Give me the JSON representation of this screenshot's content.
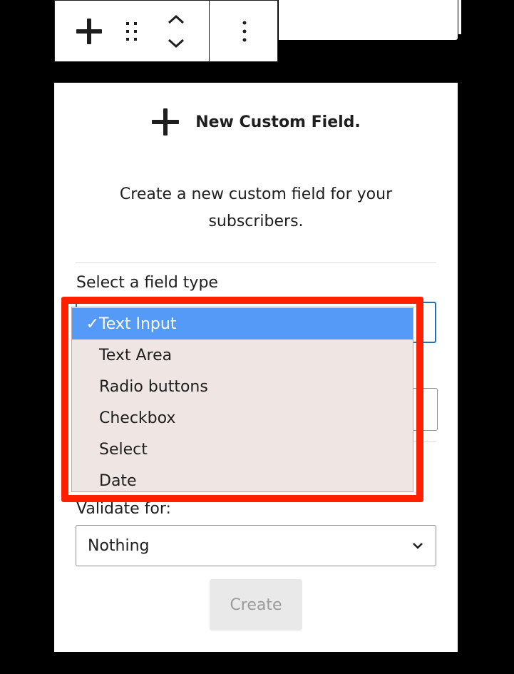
{
  "toolbar": {
    "icons": [
      "plus-icon",
      "drag-handle-icon",
      "move-up-down-icon",
      "more-options-icon"
    ]
  },
  "panel": {
    "title": "New Custom Field.",
    "description": "Create a new custom field for your subscribers.",
    "field_type_label": "Select a field type",
    "validate_label": "Validate for:",
    "validate_value": "Nothing",
    "create_label": "Create"
  },
  "dropdown": {
    "check_mark": "✓",
    "options": [
      "Text Input",
      "Text Area",
      "Radio buttons",
      "Checkbox",
      "Select",
      "Date"
    ],
    "selected": "Text Input"
  },
  "colors": {
    "selected_option": "#569af8",
    "highlight_frame": "#ff2000",
    "focus_border": "#2271b1"
  }
}
